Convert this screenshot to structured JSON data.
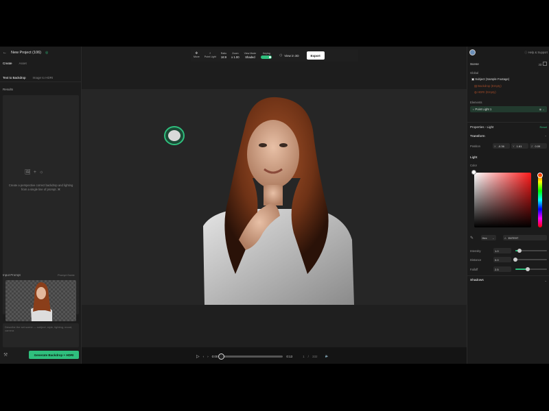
{
  "app": {
    "project_title": "New Project (106)"
  },
  "left_panel": {
    "tabs": [
      "Create",
      "Asset"
    ],
    "subtabs": [
      "Text to Backdrop",
      "Image to HDRI"
    ],
    "results_label": "Results",
    "results_hint": "Create a perspective correct backdrop and lighting from a single line of prompt. ⌘",
    "input_prompt_label": "Input Prompt",
    "prompt_guide": "Prompt Guide",
    "prompt_placeholder": "Describe the set scene — subject, style, lighting, mood, camera",
    "generate_button": "Generate Backdrop + HDRI"
  },
  "toolbar": {
    "move": "Move",
    "point_light": "Point Light",
    "ratio_label": "Ratio",
    "ratio_value": "16:9",
    "zoom_label": "Zoom",
    "zoom_value": "x 1.00",
    "view_mode_label": "View Mode",
    "view_mode_value": "Shaded",
    "keying_label": "Keying",
    "keying_on": true,
    "view_3d": "View in 3D",
    "export": "Export"
  },
  "timeline": {
    "current": "0:00",
    "end": "0:13",
    "frame": "1",
    "separator": "/",
    "total_frames": "332",
    "progress": 0
  },
  "right_panel": {
    "help": "Help & Support",
    "scene_label": "Scene",
    "scene_badge": "3D",
    "global_label": "Global",
    "subject": "Subject (Sample Footage)",
    "backdrop": "Backdrop (Empty)",
    "hdri": "HDRI (Empty)",
    "elements_label": "Elements",
    "point_light_item": "Point Light 1",
    "properties_title": "Properties - Light",
    "reset": "Reset",
    "transform_label": "Transform",
    "position_label": "Position",
    "pos_x_label": "X",
    "pos_x": "-0.36",
    "pos_y_label": "Y",
    "pos_y": "1.61",
    "pos_z_label": "Z",
    "pos_z": "0.09",
    "light_label": "Light",
    "color_label": "Color",
    "color_mode": "Hex",
    "color_alpha": "A",
    "color_hex": "E6TE9T",
    "intensity_label": "Intensity",
    "intensity_value": "1.0",
    "intensity_level": 0.12,
    "distance_label": "Distance",
    "distance_value": "0.0",
    "distance_level": 0.0,
    "falloff_label": "Falloff",
    "falloff_value": "2.5",
    "falloff_level": 0.4,
    "shadows_label": "Shadows"
  },
  "colors": {
    "accent": "#2fbf7d",
    "panel": "#1b1b1b",
    "canvas": "#262626"
  }
}
